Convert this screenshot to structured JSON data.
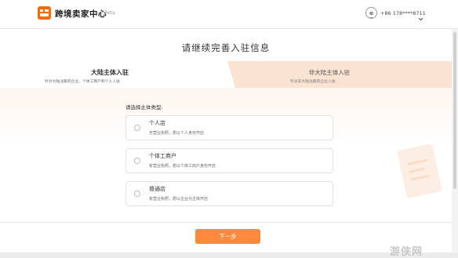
{
  "header": {
    "app_title": "跨境卖家中心",
    "beta_label": "Beta",
    "user_phone": "+86 178****8711"
  },
  "main": {
    "page_title": "请继续完善入驻信息",
    "tabs": [
      {
        "label": "大陆主体入驻",
        "description": "针对大陆注册的企业、个体工商户和个人入驻",
        "active": true
      },
      {
        "label": "非大陆主体入驻",
        "description": "针对非大陆注册的企业入驻",
        "active": false
      }
    ],
    "select_label": "请选择主体类型:",
    "options": [
      {
        "title": "个人店",
        "description": "无营业执照，想以个人身份开店"
      },
      {
        "title": "个体工商户",
        "description": "有营业执照，想以个体工商户身份开店"
      },
      {
        "title": "普通店",
        "description": "有营业执照，想以企业为主体开店"
      }
    ],
    "next_button": "下一步"
  },
  "watermark": {
    "text": "游侠网"
  },
  "colors": {
    "accent": "#ff6a00",
    "button": "#ff8a3d",
    "tab_band": "#fdf1e8"
  }
}
